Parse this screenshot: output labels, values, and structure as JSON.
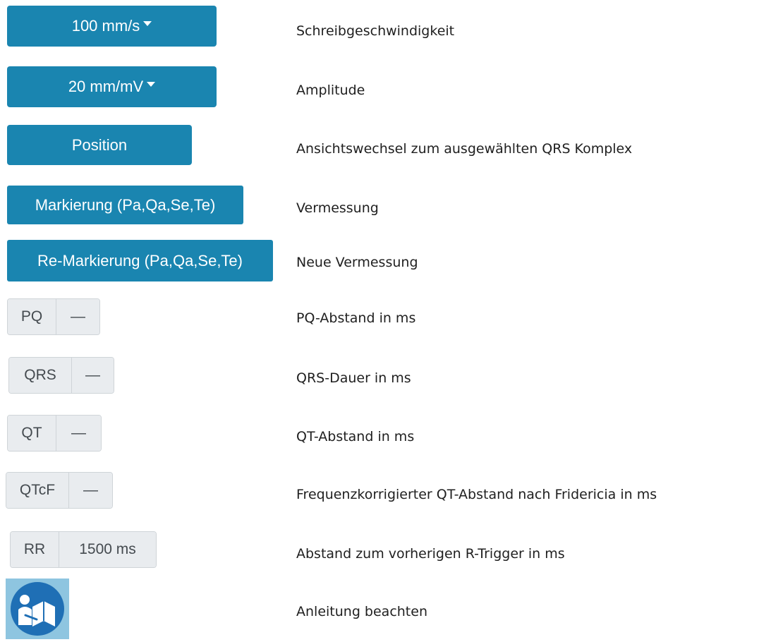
{
  "buttons": {
    "speed": "100 mm/s",
    "amplitude": "20 mm/mV",
    "position": "Position",
    "mark": "Markierung (Pa,Qa,Se,Te)",
    "remark": "Re-Markierung (Pa,Qa,Se,Te)"
  },
  "measurements": {
    "pq": {
      "label": "PQ",
      "value": "—"
    },
    "qrs": {
      "label": "QRS",
      "value": "—"
    },
    "qt": {
      "label": "QT",
      "value": "—"
    },
    "qtcf": {
      "label": "QTcF",
      "value": "—"
    },
    "rr": {
      "label": "RR",
      "value": "1500 ms"
    }
  },
  "descriptions": {
    "speed": "Schreibgeschwindigkeit",
    "amplitude": "Amplitude",
    "position": "Ansichtswechsel zum ausgewählten QRS Komplex",
    "mark": "Vermessung",
    "remark": "Neue Vermessung",
    "pq": "PQ-Abstand in ms",
    "qrs": "QRS-Dauer in ms",
    "qt": "QT-Abstand in ms",
    "qtcf": "Frequenzkorrigierter QT-Abstand nach Fridericia in ms",
    "rr": "Abstand zum vorherigen R-Trigger in ms",
    "manual": "Anleitung beachten"
  },
  "icons": {
    "manual": "read-manual-icon"
  },
  "colors": {
    "button": "#1a85b0",
    "manual_background": "#8ec5e0",
    "manual_symbol": "#1f6fb5"
  }
}
